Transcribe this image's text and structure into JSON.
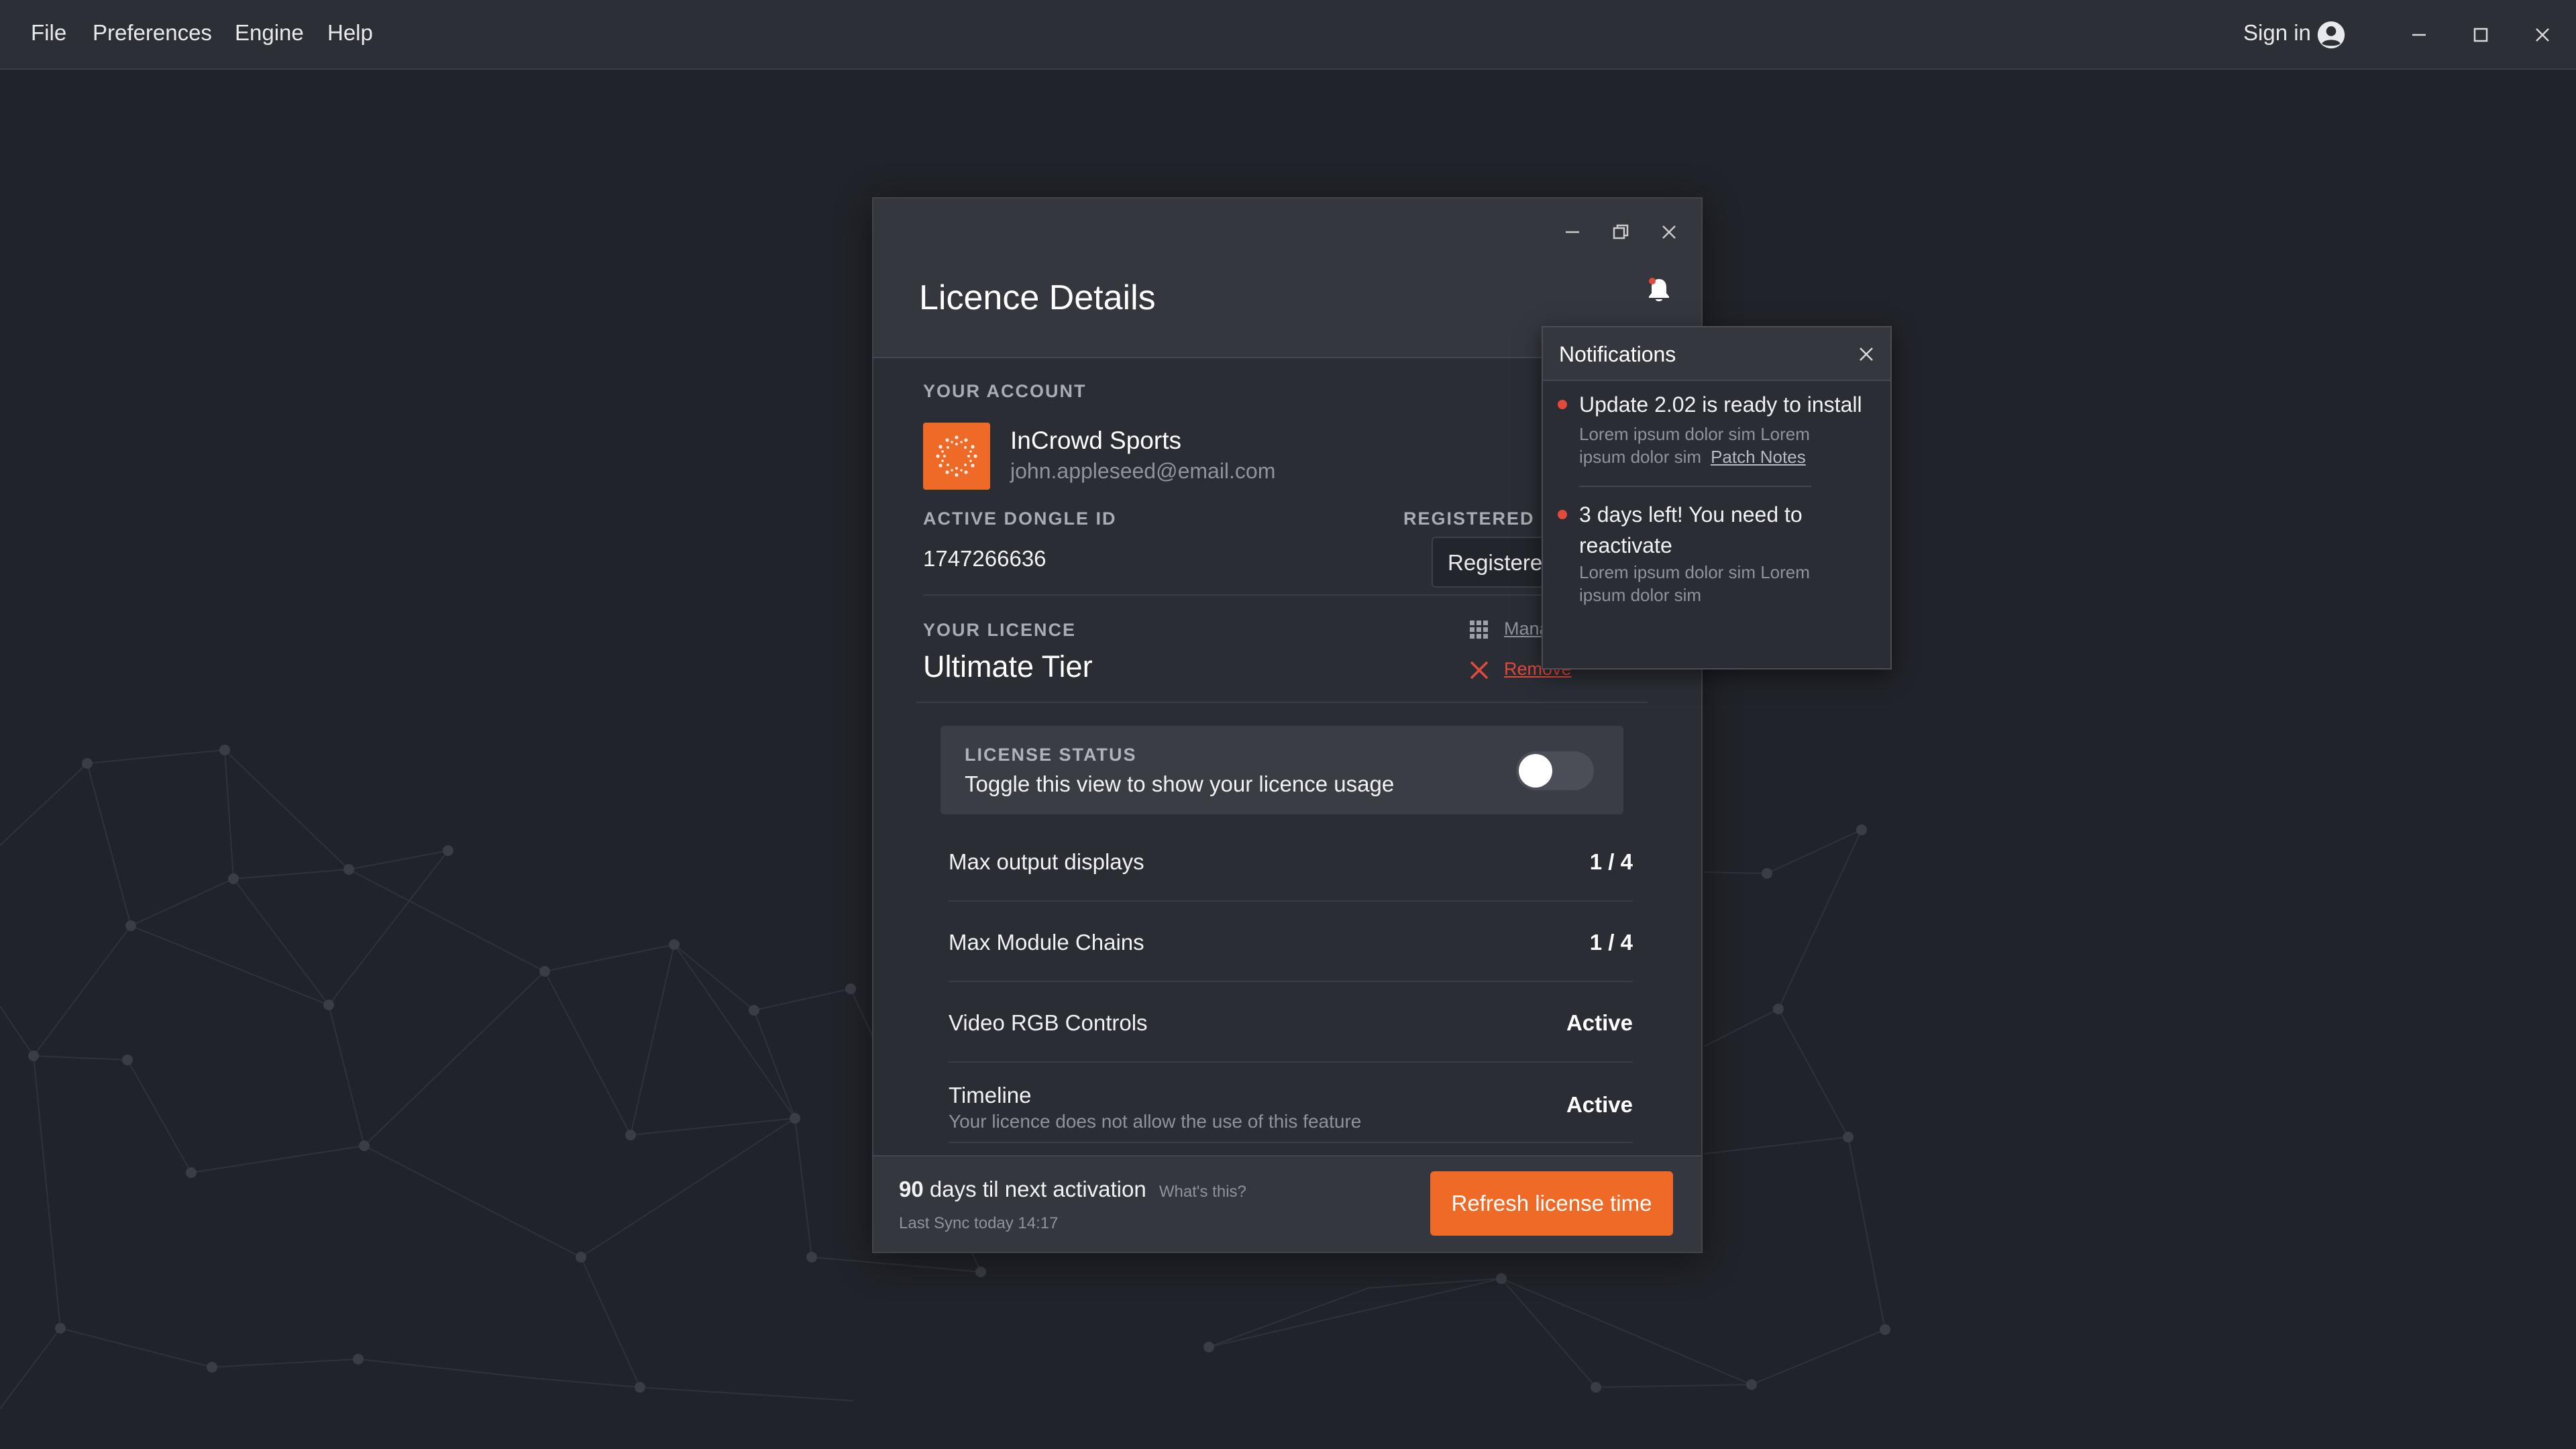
{
  "menu": {
    "items": [
      "File",
      "Preferences",
      "Engine",
      "Help"
    ],
    "sign_in": "Sign in"
  },
  "icons": {
    "avatar": "user-circle-icon",
    "window_minimize": "minimize-icon",
    "window_maximize": "maximize-icon",
    "window_close": "close-icon",
    "bell": "bell-icon",
    "manage": "grid-icon",
    "remove": "x-icon"
  },
  "colors": {
    "accent": "#ee6a26",
    "background": "#21232a",
    "panel": "#2a2d34",
    "danger": "#e24a3b"
  },
  "dialog": {
    "title": "Licence Details",
    "account": {
      "section_label": "YOUR ACCOUNT",
      "name": "InCrowd Sports",
      "email": "john.appleseed@email.com"
    },
    "dongle": {
      "section_label": "ACTIVE DONGLE ID",
      "id": "1747266636"
    },
    "registered": {
      "section_label": "REGISTERED D",
      "value": "Registered"
    },
    "licence": {
      "section_label": "YOUR LICENCE",
      "tier": "Ultimate Tier",
      "manage_label": "Mana",
      "remove_label": "Remove"
    },
    "status": {
      "title": "LICENSE STATUS",
      "description": "Toggle this view to show your licence usage",
      "toggle_on": false
    },
    "features": [
      {
        "label": "Max output displays",
        "value": "1 / 4",
        "note": ""
      },
      {
        "label": "Max Module Chains",
        "value": "1 / 4",
        "note": ""
      },
      {
        "label": "Video RGB Controls",
        "value": "Active",
        "note": ""
      },
      {
        "label": "Timeline",
        "value": "Active",
        "note": "Your licence does not allow the use of this feature"
      }
    ],
    "footer": {
      "days": "90",
      "days_text": "days til next activation",
      "whats_this": "What's this?",
      "last_sync": "Last Sync today 14:17",
      "refresh_label": "Refresh license time"
    }
  },
  "notifications": {
    "title": "Notifications",
    "items": [
      {
        "title": "Update 2.02 is ready to install",
        "body": "Lorem ipsum dolor sim Lorem ipsum dolor sim",
        "link": "Patch Notes"
      },
      {
        "title": "3 days left! You need to reactivate",
        "body": "Lorem ipsum dolor sim Lorem ipsum dolor sim",
        "link": ""
      }
    ]
  }
}
